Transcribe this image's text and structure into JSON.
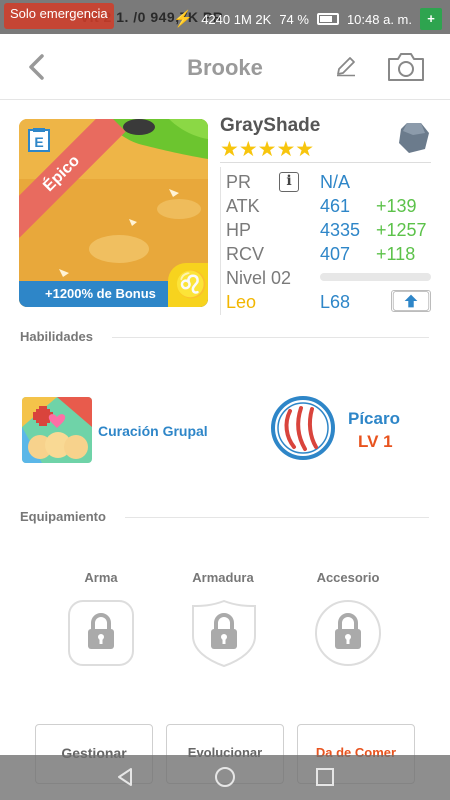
{
  "status_bar": {
    "emergency": "Solo emergencia",
    "game_overlay": "Vit 2 1. /0 949,7K PR",
    "resources": "4240 1M 2K",
    "signal_pct": "74 %",
    "time": "10:48 a. m."
  },
  "header": {
    "title": "Brooke"
  },
  "card": {
    "rarity": "Épico",
    "badge": "E",
    "bonus": "+1200% de Bonus",
    "sign_symbol": "♌"
  },
  "pet": {
    "name": "GrayShade",
    "stars": "★★★★★",
    "star_count": 5
  },
  "stats": {
    "pr": {
      "label": "PR",
      "info": "i",
      "value": "N/A"
    },
    "atk": {
      "label": "ATK",
      "value": "461",
      "bonus": "+139"
    },
    "hp": {
      "label": "HP",
      "value": "4335",
      "bonus": "+1257"
    },
    "rcv": {
      "label": "RCV",
      "value": "407",
      "bonus": "+118"
    },
    "level": {
      "label": "Nivel 02",
      "progress": 0
    },
    "sign": {
      "label": "Leo",
      "value": "L68"
    }
  },
  "skills": {
    "title": "Habilidades",
    "skill_name": "Curación Grupal",
    "class_name": "Pícaro",
    "class_level": "LV 1"
  },
  "equipment": {
    "title": "Equipamiento",
    "slots": [
      "Arma",
      "Armadura",
      "Accesorio"
    ]
  },
  "actions": {
    "manage": "Gestionar",
    "evolve": "Evolucionar",
    "feed": "Da de Comer"
  },
  "colors": {
    "accent_blue": "#2e86c8",
    "bonus_green": "#5cc24a",
    "star_gold": "#f7c50d",
    "feed_red": "#e8531e",
    "rarity_pink": "#e86b5f"
  }
}
